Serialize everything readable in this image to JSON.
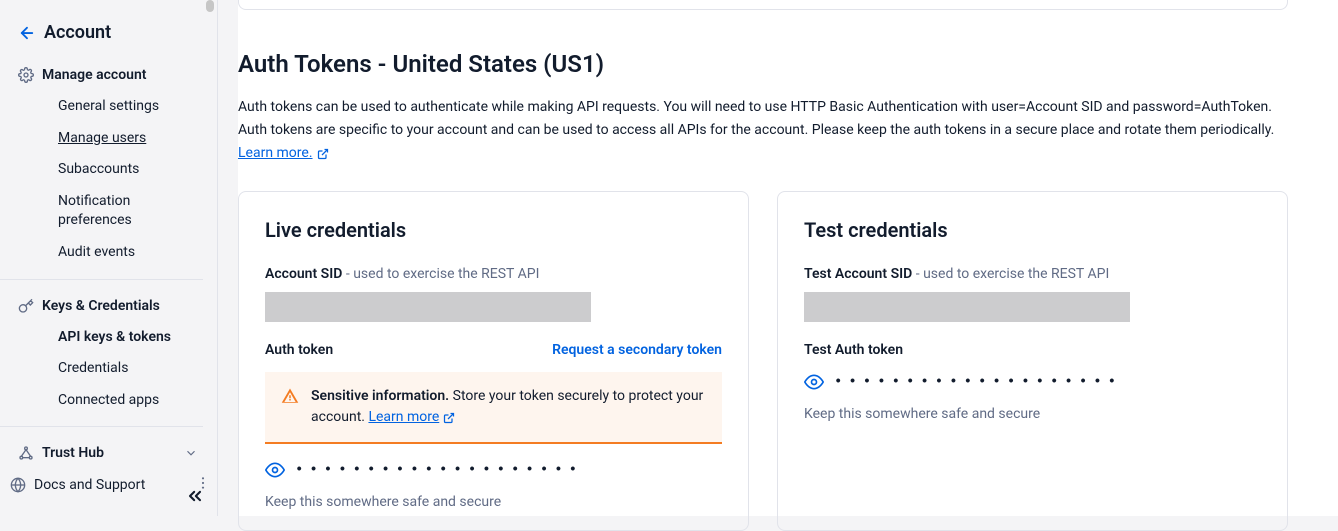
{
  "sidebar": {
    "title": "Account",
    "sections": {
      "manage": {
        "header": "Manage account",
        "items": {
          "general": "General settings",
          "users": "Manage users",
          "subaccounts": "Subaccounts",
          "notifications": "Notification preferences",
          "audit": "Audit events"
        }
      },
      "keys": {
        "header": "Keys & Credentials",
        "items": {
          "api_keys": "API keys & tokens",
          "credentials": "Credentials",
          "connected": "Connected apps"
        }
      },
      "trusthub": {
        "header": "Trust Hub"
      }
    },
    "docs": "Docs and Support"
  },
  "main": {
    "title": "Auth Tokens - United States (US1)",
    "description": "Auth tokens can be used to authenticate while making API requests. You will need to use HTTP Basic Authentication with user=Account SID and password=AuthToken. Auth tokens are specific to your account and can be used to access all APIs for the account. Please keep the auth tokens in a secure place and rotate them periodically. ",
    "learn_more": "Learn more."
  },
  "live": {
    "title": "Live credentials",
    "sid_label": "Account SID",
    "sid_hint": " - used to exercise the REST API",
    "auth_label": "Auth token",
    "request_secondary": "Request a secondary token",
    "warning_strong": "Sensitive information.",
    "warning_text": " Store your token securely to protect your account. ",
    "warning_link": "Learn more",
    "dots": "••••••••••••••••••••",
    "hint": "Keep this somewhere safe and secure"
  },
  "test": {
    "title": "Test credentials",
    "sid_label": "Test Account SID",
    "sid_hint": " - used to exercise the REST API",
    "auth_label": "Test Auth token",
    "dots": "••••••••••••••••••••",
    "hint": "Keep this somewhere safe and secure"
  }
}
